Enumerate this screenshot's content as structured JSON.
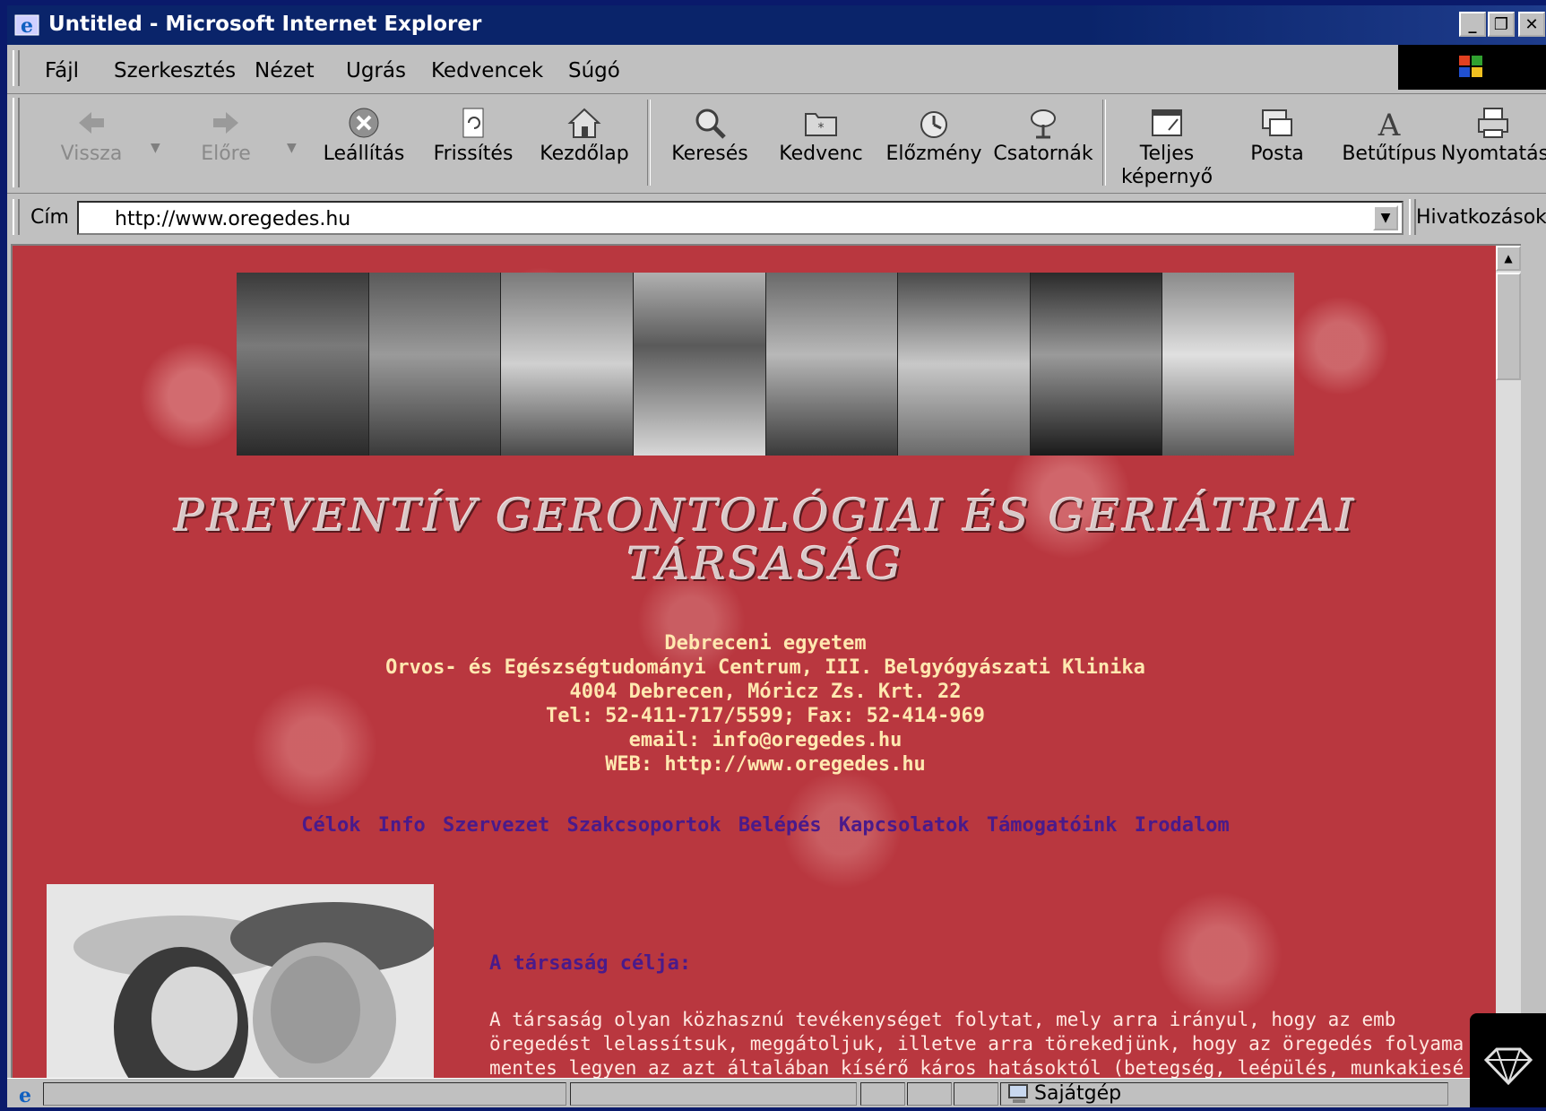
{
  "window": {
    "title": "Untitled - Microsoft Internet Explorer",
    "buttons": {
      "minimize": "_",
      "maximize": "❐",
      "close": "✕"
    }
  },
  "menu": [
    "Fájl",
    "Szerkesztés",
    "Nézet",
    "Ugrás",
    "Kedvencek",
    "Súgó"
  ],
  "toolbar": {
    "back": "Vissza",
    "forward": "Előre",
    "stop": "Leállítás",
    "refresh": "Frissítés",
    "home": "Kezdőlap",
    "search": "Keresés",
    "favorites": "Kedvenc",
    "history": "Előzmény",
    "channels": "Csatornák",
    "fullscreen": "Teljes képernyő",
    "mail": "Posta",
    "font": "Betűtípus",
    "print": "Nyomtatás"
  },
  "address": {
    "label": "Cím",
    "url": "http://www.oregedes.hu",
    "links_label": "Hivatkozások"
  },
  "page": {
    "headline_line1": "PREVENTÍV GERONTOLÓGIAI ÉS GERIÁTRIAI",
    "headline_line2": "TÁRSASÁG",
    "contact": [
      "Debreceni egyetem",
      "Orvos- és Egészségtudományi Centrum, III. Belgyógyászati Klinika",
      "4004 Debrecen, Móricz Zs. Krt. 22",
      "Tel: 52-411-717/5599; Fax: 52-414-969",
      "email: info@oregedes.hu",
      "WEB: http://www.oregedes.hu"
    ],
    "nav": [
      "Célok",
      "Info",
      "Szervezet",
      "Szakcsoportok",
      "Belépés",
      "Kapcsolatok",
      "Támogatóink",
      "Irodalom"
    ],
    "goal_title": "A társaság célja:",
    "goal_text_lines": [
      "A társaság olyan közhasznú tevékenységet folytat, mely arra irányul, hogy az emb",
      "öregedést lelassítsuk, meggátoljuk, illetve arra törekedjünk, hogy az öregedés folyama",
      "mentes legyen az azt általában kísérő káros hatásoktól (betegség, leépülés, munkakiesé"
    ]
  },
  "status": {
    "zone": "Sajátgép"
  }
}
